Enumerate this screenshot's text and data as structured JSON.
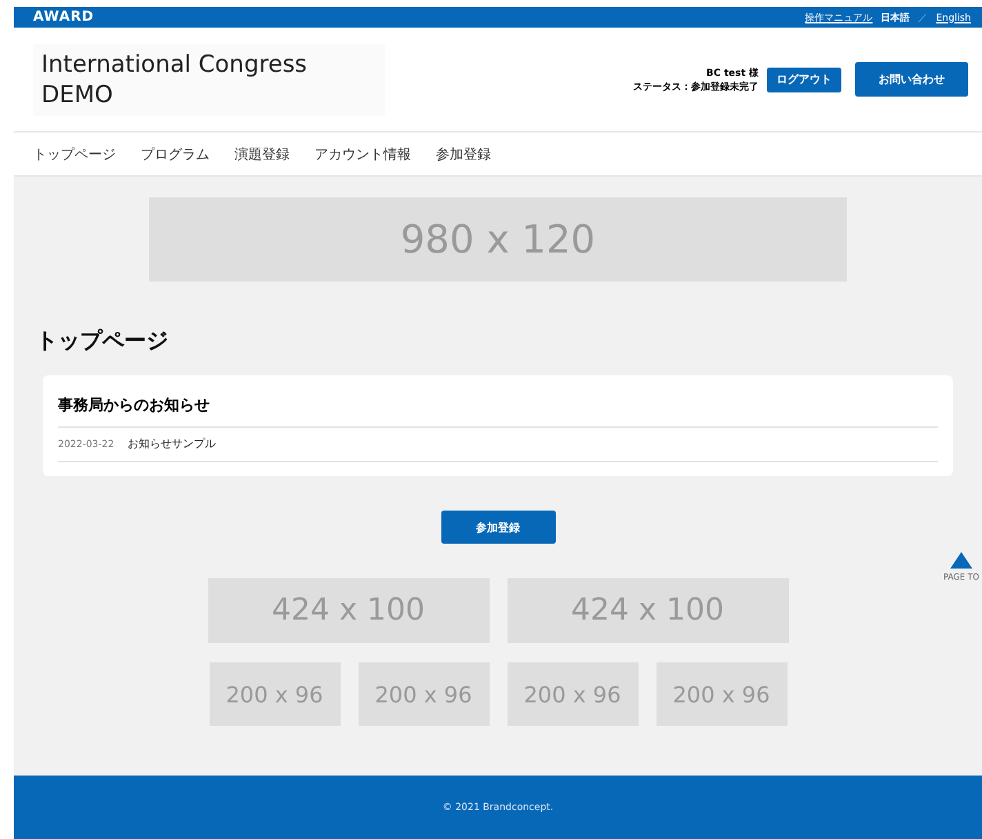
{
  "topbar": {
    "logo": "AWARD",
    "links": [
      {
        "label": "操作マニュアル",
        "selected": false
      },
      {
        "label": "日本語",
        "selected": true
      },
      {
        "label": "English",
        "selected": false
      }
    ],
    "separator": "／"
  },
  "header": {
    "title_lines": [
      "International Congress",
      "DEMO"
    ],
    "user": "BC test 様",
    "status": "ステータス：参加登録未完了",
    "logout": "ログアウト",
    "contact": "お問い合わせ"
  },
  "nav": [
    "トップページ",
    "プログラム",
    "演題登録",
    "アカウント情報",
    "参加登録"
  ],
  "banner_top": "980 x 120",
  "page_title": "トップページ",
  "notices": {
    "title": "事務局からのお知らせ",
    "items": [
      {
        "date": "2022-03-22",
        "text": "お知らせサンプル"
      }
    ]
  },
  "register_button": "参加登録",
  "banners_large": [
    "424 x 100",
    "424 x 100"
  ],
  "banners_small": [
    "200 x 96",
    "200 x 96",
    "200 x 96",
    "200 x 96"
  ],
  "page_top": "PAGE TO",
  "footer": "© 2021 Brandconcept."
}
